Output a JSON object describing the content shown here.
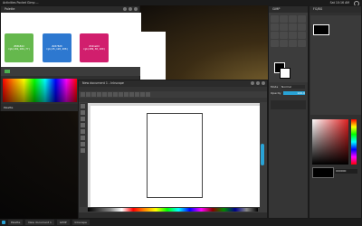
{
  "topbar": {
    "menu": "Activities  Pocket  Gimp  ...",
    "clock": "Sat 10:16 AM"
  },
  "palette_window": {
    "title": "Palette",
    "swatches": [
      {
        "hex": "#65b84d",
        "label_top": "#65b84d",
        "label_bottom": "rgb(101,184,77)"
      },
      {
        "hex": "#2d78d0",
        "label_top": "#2d78d0",
        "label_bottom": "rgb(45,120,208)"
      },
      {
        "hex": "#d11e6d",
        "label_top": "#d11e6d",
        "label_bottom": "rgb(209,30,109)"
      }
    ],
    "status": "Palette"
  },
  "inkscape_window": {
    "title": "New document 1 - Inkscape"
  },
  "gimp_toolbox": {
    "title": "GIMP",
    "mode_label": "Mode",
    "mode_value": "Normal",
    "opacity_label": "Opacity",
    "opacity_value": "100.0"
  },
  "color_window": {
    "title": "FG/BG",
    "hex_value": "000000"
  },
  "taskbar": {
    "items": [
      "Palette",
      "New document 1",
      "GIMP",
      "Inkscape"
    ]
  },
  "colors": {
    "accent_cyan": "#29a3d6",
    "panel_bg": "#3a3a3a"
  }
}
